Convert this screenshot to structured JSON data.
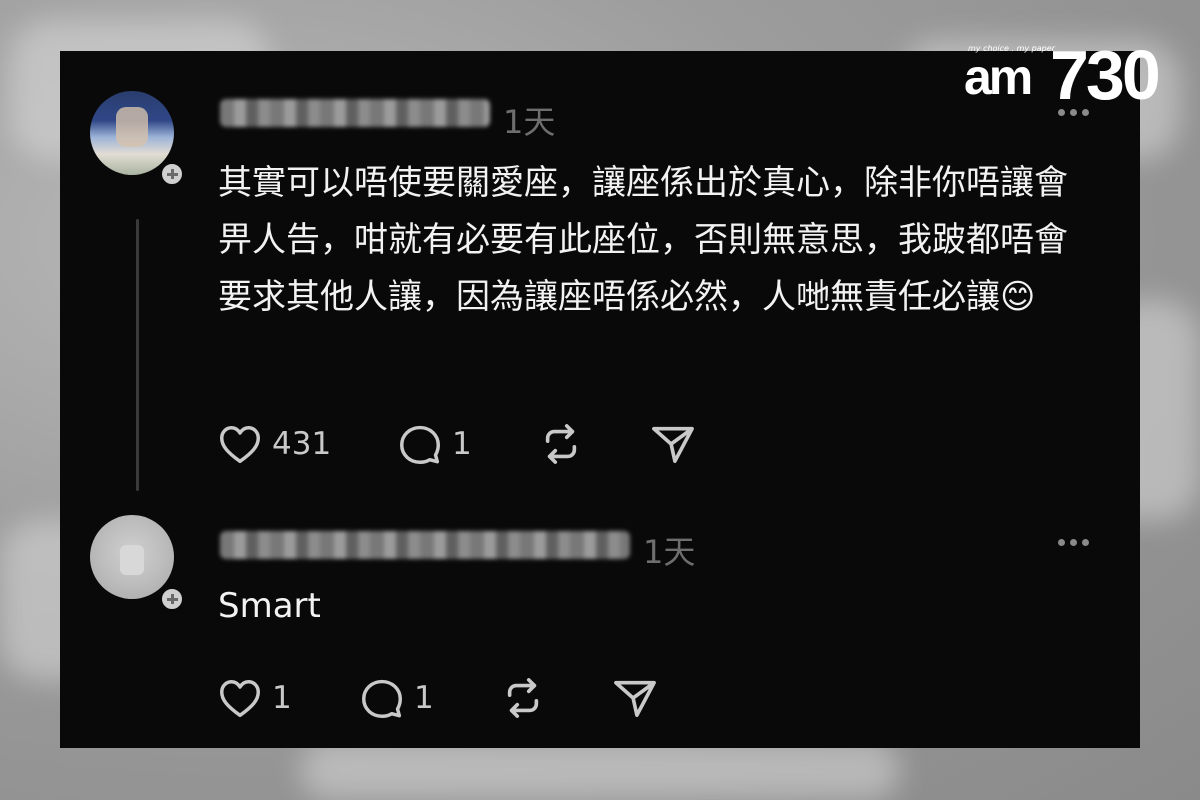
{
  "brand": {
    "tagline": "my choice . my paper",
    "wordmark_left": "am",
    "wordmark_right": "730"
  },
  "comments": [
    {
      "time": "1天",
      "text": "其實可以唔使要關愛座，讓座係出於真心，除非你唔讓會畀人告，咁就有必要有此座位，否則無意思，我跛都唔會要求其他人讓，因為讓座唔係必然，人哋無責任必讓😊",
      "likes": "431",
      "replies": "1"
    },
    {
      "time": "1天",
      "text": "Smart",
      "likes": "1",
      "replies": "1"
    }
  ],
  "icons": [
    "heart-icon",
    "comment-icon",
    "repost-icon",
    "send-icon",
    "more-icon",
    "plus-icon"
  ],
  "colors": {
    "card_bg": "#090909",
    "text": "#f2f2f2",
    "muted": "#6e6e6e",
    "icon": "#c9c9c9"
  }
}
